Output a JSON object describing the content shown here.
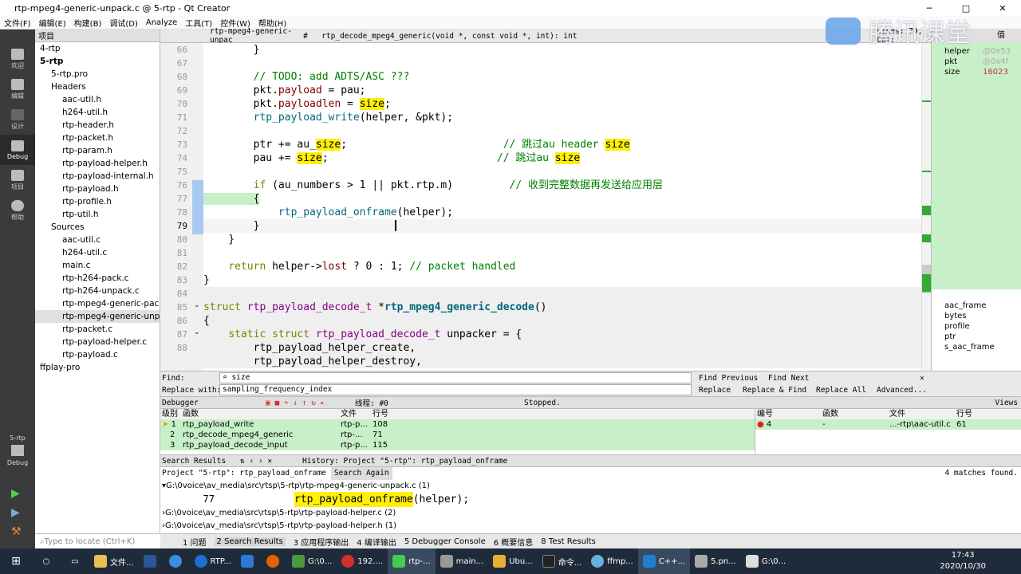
{
  "window": {
    "title": "rtp-mpeg4-generic-unpack.c @ 5-rtp - Qt Creator"
  },
  "menu": [
    "文件(F)",
    "编辑(E)",
    "构建(B)",
    "调试(D)",
    "Analyze",
    "工具(T)",
    "控件(W)",
    "帮助(H)"
  ],
  "modes": [
    "欢迎",
    "编辑",
    "设计",
    "Debug",
    "项目",
    "帮助"
  ],
  "kit": {
    "project": "5-rtp",
    "mode": "Debug"
  },
  "projects": {
    "header": "项目",
    "tree": [
      "4-rtp",
      "5-rtp",
      "5-rtp.pro",
      "Headers",
      "aac-util.h",
      "h264-util.h",
      "rtp-header.h",
      "rtp-packet.h",
      "rtp-param.h",
      "rtp-payload-helper.h",
      "rtp-payload-internal.h",
      "rtp-payload.h",
      "rtp-profile.h",
      "rtp-util.h",
      "Sources",
      "aac-util.c",
      "h264-util.c",
      "main.c",
      "rtp-h264-pack.c",
      "rtp-h264-unpack.c",
      "rtp-mpeg4-generic-pack",
      "rtp-mpeg4-generic-unpa",
      "rtp-packet.c",
      "rtp-payload-helper.c",
      "rtp-payload.c",
      "ffplay-pro"
    ]
  },
  "editor": {
    "file": "rtp-mpeg4-generic-unpac",
    "symbol": "rtp_decode_mpeg4_generic(void *, const void *, int): int",
    "lines_label": "Lines: 79, Col:",
    "line_numbers": [
      "66",
      "67",
      "68",
      "69",
      "70",
      "71",
      "72",
      "73",
      "74",
      "75",
      "76",
      "77",
      "78",
      "79",
      "80",
      "81",
      "82",
      "83",
      "84",
      "85",
      "86",
      "87",
      "88"
    ],
    "code": {
      "l66": "        }",
      "l68": "        // TODO: add ADTS/ASC ???",
      "l69a": "        pkt.",
      "l69b": "payload",
      "l69c": " = pau;",
      "l70a": "        pkt.",
      "l70b": "payloadlen",
      "l70c": " = ",
      "l70d": "size",
      "l70e": ";",
      "l71a": "        ",
      "l71b": "rtp_payload_write",
      "l71c": "(helper, &pkt);",
      "l73a": "        ptr += au_",
      "l73b": "size",
      "l73c": ";                         ",
      "l73d": "// 跳过au header ",
      "l73e": "size",
      "l74a": "        pau += ",
      "l74b": "size",
      "l74c": ";                           ",
      "l74d": "// 跳过au ",
      "l74e": "size",
      "l76a": "        ",
      "l76b": "if",
      "l76c": " (au_numbers > 1 || pkt.rtp.m)         ",
      "l76d": "// 收到完整数据再发送给应用层",
      "l77": "        {",
      "l78a": "            ",
      "l78b": "rtp_payload_onframe",
      "l78c": "(helper);",
      "l79": "        }",
      "l80": "    }",
      "l82a": "    ",
      "l82b": "return",
      "l82c": " helper->",
      "l82d": "lost",
      "l82e": " ? 0 : 1; ",
      "l82f": "// packet handled",
      "l83": "}",
      "l85a": "struct ",
      "l85b": "rtp_payload_decode_t",
      "l85c": " *",
      "l85d": "rtp_mpeg4_generic_decode",
      "l85e": "()",
      "l86": "{",
      "l87a": "    ",
      "l87b": "static struct ",
      "l87c": "rtp_payload_decode_t",
      "l87d": " unpacker = {",
      "l88": "        rtp_payload_helper_create,",
      "l89": "        rtp_payload_helper_destroy,"
    }
  },
  "locals": {
    "header": "值",
    "items": [
      {
        "name": "helper",
        "value": "@0x53"
      },
      {
        "name": "pkt",
        "value": "@0x4f"
      },
      {
        "name": "size",
        "value": "16023"
      }
    ],
    "tree": [
      "aac_frame",
      "bytes",
      "profile",
      "ptr",
      "s_aac_frame"
    ]
  },
  "find": {
    "find_label": "Find:",
    "find_value": "size",
    "replace_label": "Replace with:",
    "replace_value": "sampling_frequency_index",
    "find_prev": "Find Previous",
    "find_next": "Find Next",
    "replace": "Replace",
    "replace_find": "Replace & Find",
    "replace_all": "Replace All",
    "advanced": "Advanced..."
  },
  "debugger": {
    "label": "Debugger",
    "thread": "线程: #0",
    "status": "Stopped.",
    "views": "Views"
  },
  "stack": {
    "headers": [
      "级别",
      "函数",
      "文件",
      "行号"
    ],
    "rows": [
      [
        "1",
        "rtp_payload_write",
        "rtp-p...",
        "108"
      ],
      [
        "2",
        "rtp_decode_mpeg4_generic",
        "rtp-...",
        "71"
      ],
      [
        "3",
        "rtp_payload_decode_input",
        "rtp-p...",
        "115"
      ]
    ]
  },
  "breakpoints": {
    "headers": [
      "编号",
      "函数",
      "文件",
      "行号"
    ],
    "rows": [
      [
        "4",
        "-",
        "...-rtp\\aac-util.c",
        "61"
      ]
    ]
  },
  "search": {
    "title": "Search Results",
    "history": "History: Project \"5-rtp\": rtp_payload_onframe",
    "query": "Project \"5-rtp\": rtp_payload_onframe",
    "search_again": "Search Again",
    "matches": "4 matches found.",
    "files": [
      "G:\\0voice\\av_media\\src\\rtsp\\5-rtp\\rtp-mpeg4-generic-unpack.c (1)",
      "G:\\0voice\\av_media\\src\\rtsp\\5-rtp\\rtp-payload-helper.c (2)",
      "G:\\0voice\\av_media\\src\\rtsp\\5-rtp\\rtp-payload-helper.h (1)"
    ],
    "hit_line": "77",
    "hit_code_a": "rtp_payload_onframe",
    "hit_code_b": "(helper);"
  },
  "output_tabs": [
    "1 问题",
    "2 Search Results",
    "3 应用程序输出",
    "4 编译输出",
    "5 Debugger Console",
    "6 概要信息",
    "8 Test Results"
  ],
  "locate": "Type to locate (Ctrl+K)",
  "taskbar": {
    "apps": [
      "文件...",
      "",
      "",
      "RTP...",
      "",
      "",
      "G:\\0...",
      "192....",
      "rtp-...",
      "main...",
      "Ubu...",
      "命令...",
      "ffmp...",
      "C++...",
      "5.pn...",
      "G:\\0..."
    ],
    "time": "17:43",
    "date": "2020/10/30"
  },
  "watermark": "腾讯课堂",
  "colors": {
    "keyword": "#808000",
    "function": "#00677c",
    "comment": "#008000",
    "highlight": "#ffef0b"
  }
}
